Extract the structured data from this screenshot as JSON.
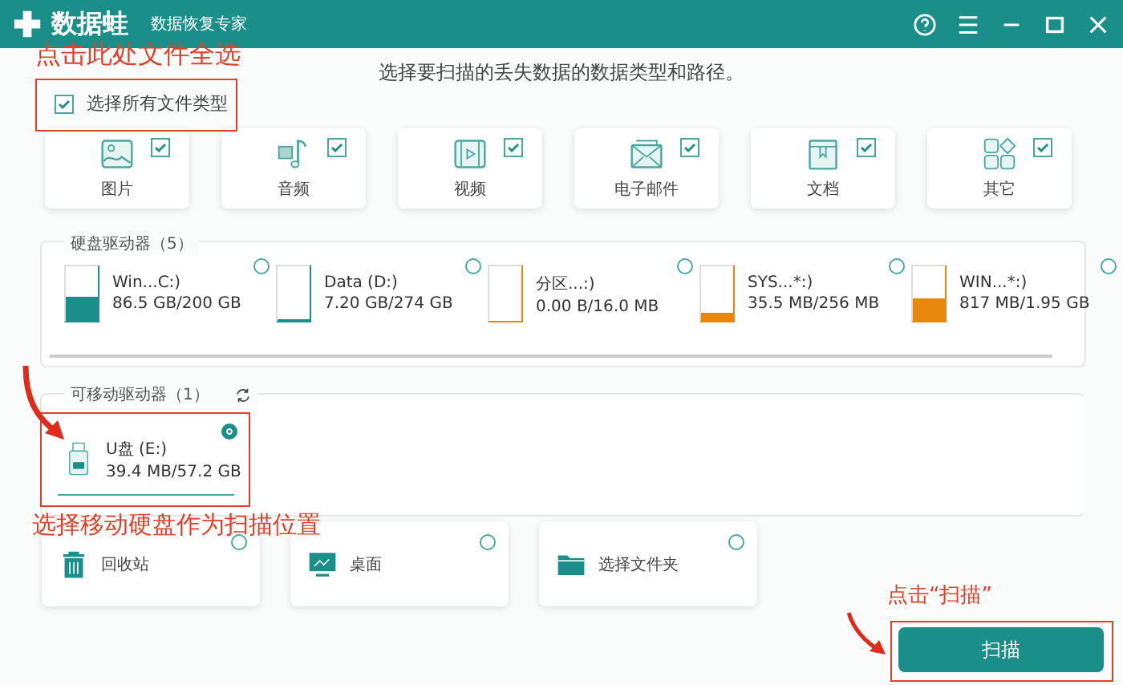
{
  "app": {
    "name": "数据蛙",
    "tagline": "数据恢复专家"
  },
  "subtitle": "选择要扫描的丢失数据的数据类型和路径。",
  "select_all": {
    "label": "选择所有文件类型",
    "checked": true
  },
  "file_types": [
    {
      "label": "图片",
      "kind": "image",
      "checked": true
    },
    {
      "label": "音频",
      "kind": "audio",
      "checked": true
    },
    {
      "label": "视频",
      "kind": "video",
      "checked": true
    },
    {
      "label": "电子邮件",
      "kind": "email",
      "checked": true
    },
    {
      "label": "文档",
      "kind": "document",
      "checked": true
    },
    {
      "label": "其它",
      "kind": "other",
      "checked": true
    }
  ],
  "hard_drives": {
    "title": "硬盘驱动器（5）",
    "drives": [
      {
        "name": "Win...C:)",
        "usage": "86.5 GB/200 GB",
        "level": 0.43,
        "color": "#1a8f8a",
        "selected": false
      },
      {
        "name": "Data (D:)",
        "usage": "7.20 GB/274 GB",
        "level": 0.03,
        "color": "#1a8f8a",
        "selected": false
      },
      {
        "name": "分区...:)",
        "usage": "0.00  B/16.0 MB",
        "level": 0,
        "color": "#e8870e",
        "selected": false
      },
      {
        "name": "SYS...*:)",
        "usage": "35.5 MB/256 MB",
        "level": 0.14,
        "color": "#e8870e",
        "selected": false
      },
      {
        "name": "WIN...*:)",
        "usage": "817 MB/1.95 GB",
        "level": 0.41,
        "color": "#e8870e",
        "selected": false
      }
    ]
  },
  "removable_drives": {
    "title": "可移动驱动器（1）",
    "drives": [
      {
        "name": "U盘 (E:)",
        "usage": "39.4 MB/57.2 GB",
        "selected": true
      }
    ]
  },
  "locations": [
    {
      "label": "回收站",
      "kind": "recycle",
      "selected": false
    },
    {
      "label": "桌面",
      "kind": "desktop",
      "selected": false
    },
    {
      "label": "选择文件夹",
      "kind": "folder",
      "selected": false
    }
  ],
  "scan_button": "扫描",
  "annotations": [
    {
      "text": "点击此处文件全选"
    },
    {
      "text": "选择移动硬盘作为扫描位置"
    },
    {
      "text": "点击“扫描”"
    }
  ]
}
